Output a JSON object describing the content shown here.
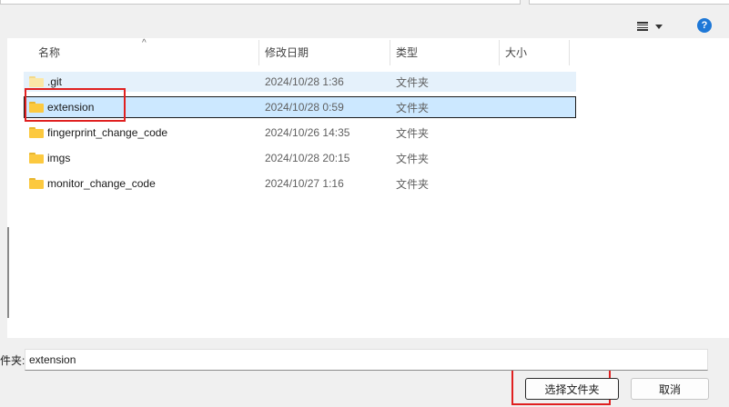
{
  "columns": {
    "name": "名称",
    "modified": "修改日期",
    "type": "类型",
    "size": "大小"
  },
  "files": [
    {
      "name": ".git",
      "modified": "2024/10/28 1:36",
      "type": "文件夹",
      "icon": "folder-icon"
    },
    {
      "name": "extension",
      "modified": "2024/10/28 0:59",
      "type": "文件夹",
      "icon": "folder-icon"
    },
    {
      "name": "fingerprint_change_code",
      "modified": "2024/10/26 14:35",
      "type": "文件夹",
      "icon": "folder-icon"
    },
    {
      "name": "imgs",
      "modified": "2024/10/28 20:15",
      "type": "文件夹",
      "icon": "folder-icon"
    },
    {
      "name": "monitor_change_code",
      "modified": "2024/10/27 1:16",
      "type": "文件夹",
      "icon": "folder-icon"
    }
  ],
  "selected_index": 1,
  "folder_field": {
    "label": "件夹:",
    "value": "extension"
  },
  "buttons": {
    "select_folder": "选择文件夹",
    "cancel": "取消"
  },
  "help_label": "?",
  "colors": {
    "selection": "#cce8ff",
    "hover": "#e5f1fb",
    "annotation": "#e02020",
    "help": "#1e78d7"
  }
}
